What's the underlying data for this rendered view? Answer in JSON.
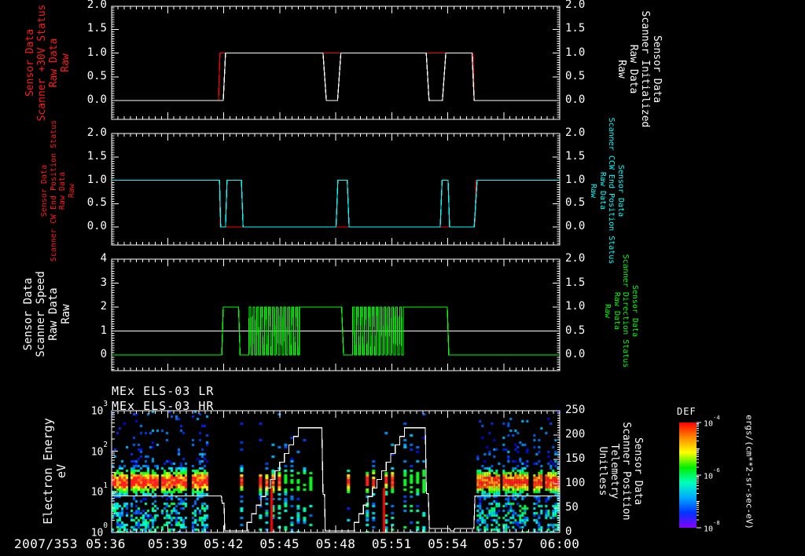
{
  "xaxis": {
    "date": "2007/353",
    "tick_labels": [
      "05:36",
      "05:39",
      "05:42",
      "05:45",
      "05:48",
      "05:51",
      "05:54",
      "05:57",
      "06:00"
    ],
    "start_minute": 0,
    "end_minute": 24,
    "major_tick_minutes": 3,
    "minor_ticks_per_minute": 3
  },
  "colorbar": {
    "title": "DEF",
    "tick_labels": [
      "10^-4",
      "10^-6",
      "10^-8"
    ],
    "unit": "ergs/(cm**2-sr-sec-eV)",
    "colors_top_to_bottom": [
      "#ff0000",
      "#ff8800",
      "#ffff00",
      "#00ee00",
      "#00ffbb",
      "#00aaff",
      "#0033ff",
      "#8800ff"
    ]
  },
  "chart_data": [
    {
      "type": "line",
      "panel": "scanner-30v-status",
      "left_label": {
        "lines": [
          "Sensor Data",
          "Scanner +30V Status",
          "Raw Data",
          "Raw"
        ],
        "color": "#ff1a1a"
      },
      "right_label": {
        "lines": [
          "Sensor Data",
          "Scanner Initialized",
          "Raw Data",
          "Raw"
        ],
        "color": "#ffffff"
      },
      "y_ticks_left": [
        "2.0",
        "1.5",
        "1.0",
        "0.5",
        "0.0"
      ],
      "y_ticks_right": [
        "2.0",
        "1.5",
        "1.0",
        "0.5",
        "0.0"
      ],
      "ylim": [
        0,
        2
      ],
      "series": [
        {
          "name": "Scanner +30V Status Raw",
          "color": "#ff0000",
          "points": [
            [
              0,
              0
            ],
            [
              5.72,
              0
            ],
            [
              5.8,
              1
            ],
            [
              19.35,
              1
            ],
            [
              19.42,
              0
            ],
            [
              24,
              0
            ]
          ]
        },
        {
          "name": "Scanner Initialized Raw",
          "color": "#ffffff",
          "points": [
            [
              0,
              0
            ],
            [
              5.98,
              0
            ],
            [
              6.1,
              1
            ],
            [
              11.32,
              1
            ],
            [
              11.5,
              0
            ],
            [
              12.1,
              0
            ],
            [
              12.28,
              1
            ],
            [
              16.85,
              1
            ],
            [
              17.0,
              0
            ],
            [
              17.72,
              0
            ],
            [
              17.9,
              1
            ],
            [
              19.3,
              1
            ],
            [
              19.42,
              0
            ],
            [
              24,
              0
            ]
          ]
        }
      ]
    },
    {
      "type": "line",
      "panel": "scanner-end-position",
      "left_label": {
        "lines": [
          "Sensor Data",
          "Scanner CW End Position Status",
          "Raw Data",
          "Raw"
        ],
        "color": "#ff1a1a"
      },
      "right_label": {
        "lines": [
          "Sensor Data",
          "Scanner CCW End Position Status",
          "Raw Data",
          "Raw"
        ],
        "color": "#00ffff"
      },
      "y_ticks_left": [
        "2.0",
        "1.5",
        "1.0",
        "0.5",
        "0.0"
      ],
      "y_ticks_right": [
        "2.0",
        "1.5",
        "1.0",
        "0.5",
        "0.0"
      ],
      "ylim": [
        0,
        2
      ],
      "series": [
        {
          "name": "Scanner CW End Position Status Raw",
          "color": "#ff0000",
          "points": [
            [
              0,
              1
            ],
            [
              5.78,
              1
            ],
            [
              5.82,
              0
            ],
            [
              19.45,
              0
            ],
            [
              19.52,
              1
            ],
            [
              24,
              1
            ]
          ]
        },
        {
          "name": "Scanner CCW End Position Status Raw",
          "color": "#00ffff",
          "points": [
            [
              0,
              1
            ],
            [
              5.78,
              1
            ],
            [
              5.84,
              0
            ],
            [
              6.1,
              0
            ],
            [
              6.18,
              1
            ],
            [
              6.95,
              1
            ],
            [
              7.04,
              0
            ],
            [
              12.02,
              0
            ],
            [
              12.12,
              1
            ],
            [
              12.62,
              1
            ],
            [
              12.72,
              0
            ],
            [
              17.6,
              0
            ],
            [
              17.7,
              1
            ],
            [
              18.02,
              1
            ],
            [
              18.1,
              0
            ],
            [
              19.42,
              0
            ],
            [
              19.58,
              1
            ],
            [
              24,
              1
            ]
          ]
        }
      ]
    },
    {
      "type": "line",
      "panel": "scanner-speed-direction",
      "left_label": {
        "lines": [
          "Sensor Data",
          "Scanner Speed",
          "Raw Data",
          "Raw"
        ],
        "color": "#ffffff"
      },
      "right_label": {
        "lines": [
          "Sensor Data",
          "Scanner Direction Status",
          "Raw Data",
          "Raw"
        ],
        "color": "#00ff00"
      },
      "y_ticks_left": [
        "4",
        "3",
        "2",
        "1",
        "0"
      ],
      "y_ticks_right": [
        "2.0",
        "1.5",
        "1.0",
        "0.5",
        "0.0"
      ],
      "ylim_left": [
        0,
        4
      ],
      "ylim_right": [
        0,
        2
      ],
      "series": [
        {
          "name": "Scanner Speed Raw",
          "color": "#ffffff",
          "points": [
            [
              0,
              1
            ],
            [
              24,
              1
            ]
          ]
        },
        {
          "name": "Scanner Direction Status Raw",
          "color": "#00ff00",
          "segments": [
            {
              "type": "points",
              "pts": [
                [
                  0,
                  0
                ],
                [
                  5.9,
                  0
                ],
                [
                  5.98,
                  2
                ],
                [
                  6.8,
                  2
                ],
                [
                  6.88,
                  0
                ],
                [
                  7.32,
                  0
                ]
              ]
            },
            {
              "type": "square",
              "t0": 7.35,
              "t1": 10.05,
              "cycles": 13,
              "lo": 0,
              "hi": 2
            },
            {
              "type": "points",
              "pts": [
                [
                  10.05,
                  2
                ],
                [
                  12.32,
                  2
                ],
                [
                  12.42,
                  0
                ],
                [
                  12.86,
                  0
                ]
              ]
            },
            {
              "type": "square",
              "t0": 12.9,
              "t1": 15.62,
              "cycles": 13,
              "lo": 0,
              "hi": 2
            },
            {
              "type": "points",
              "pts": [
                [
                  15.62,
                  2
                ],
                [
                  17.98,
                  2
                ],
                [
                  18.06,
                  0
                ],
                [
                  24,
                  0
                ]
              ]
            }
          ]
        }
      ]
    },
    {
      "type": "spectrogram",
      "panel": "els-energy-spectrogram",
      "titles": [
        "MEx ELS-03 LR",
        "MEx ELS-03 HR"
      ],
      "left_label": {
        "lines": [
          "Electron Energy",
          "eV"
        ],
        "color": "#ffffff"
      },
      "right_label": {
        "lines": [
          "Sensor Data",
          "Scanner Position",
          "Telemetry",
          "Unitless"
        ],
        "color": "#ffffff"
      },
      "y_ticks_left": [
        "10^3",
        "10^2",
        "10^1",
        "10^0"
      ],
      "y_ticks_right": [
        "250",
        "200",
        "150",
        "100",
        "50",
        "0"
      ],
      "energy_log_range": [
        0,
        3
      ],
      "right_scale_range": [
        0,
        250
      ],
      "band_center_logE": 1.25,
      "blocks": [
        {
          "t0": 0.0,
          "t1": 5.15,
          "style": "dense",
          "gaps": [
            0.9,
            2.5,
            4.1
          ]
        },
        {
          "t0": 6.88,
          "t1": 10.8,
          "style": "striped",
          "hot_until": 9.15
        },
        {
          "t0": 12.6,
          "t1": 17.0,
          "style": "striped",
          "hot_until": 15.6
        },
        {
          "t0": 19.55,
          "t1": 24.0,
          "style": "dense",
          "gaps": [
            20.8,
            22.4,
            23.1
          ]
        }
      ],
      "red_streak_minutes": [
        8.55,
        14.57
      ],
      "red_streak_logE_max": 1.1,
      "overlay": {
        "name": "Scanner Position Telemetry",
        "color": "#ffffff",
        "segments": [
          {
            "type": "points",
            "pts": [
              [
                0,
                75
              ],
              [
                5.88,
                75
              ],
              [
                5.92,
                60
              ],
              [
                6.02,
                60
              ],
              [
                6.06,
                3
              ],
              [
                7.0,
                3
              ]
            ]
          },
          {
            "type": "stair",
            "t0": 7.0,
            "t1": 10.0,
            "v0": 3,
            "v1": 215,
            "steps": 12
          },
          {
            "type": "points",
            "pts": [
              [
                10.0,
                215
              ],
              [
                11.26,
                215
              ],
              [
                11.32,
                78
              ],
              [
                11.4,
                78
              ],
              [
                11.44,
                3
              ],
              [
                12.75,
                3
              ]
            ]
          },
          {
            "type": "stair",
            "t0": 12.75,
            "t1": 15.68,
            "v0": 3,
            "v1": 215,
            "steps": 12
          },
          {
            "type": "points",
            "pts": [
              [
                15.68,
                215
              ],
              [
                16.8,
                215
              ],
              [
                16.86,
                80
              ],
              [
                16.96,
                80
              ],
              [
                17.02,
                8
              ],
              [
                18.1,
                8
              ],
              [
                18.16,
                3
              ],
              [
                18.32,
                3
              ],
              [
                18.38,
                8
              ],
              [
                19.4,
                8
              ],
              [
                19.46,
                75
              ],
              [
                24,
                75
              ]
            ]
          }
        ]
      }
    }
  ]
}
